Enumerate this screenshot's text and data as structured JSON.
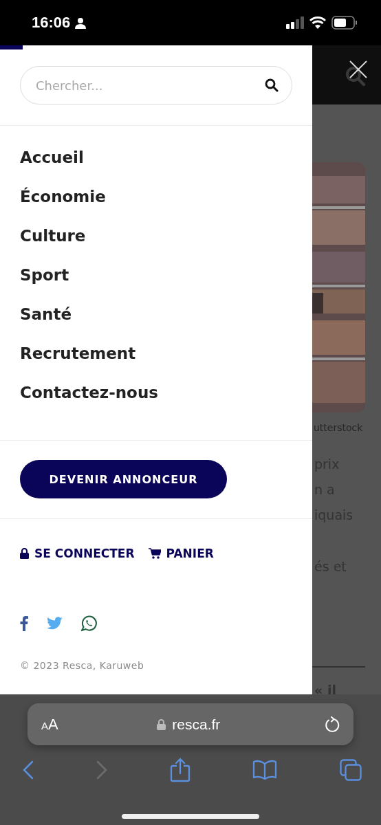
{
  "status_bar": {
    "time": "16:06"
  },
  "search": {
    "placeholder": "Chercher..."
  },
  "menu": [
    {
      "label": "Accueil"
    },
    {
      "label": "Économie"
    },
    {
      "label": "Culture"
    },
    {
      "label": "Sport"
    },
    {
      "label": "Santé"
    },
    {
      "label": "Recrutement"
    },
    {
      "label": "Contactez-nous"
    }
  ],
  "cta_button": "DEVENIR ANNONCEUR",
  "account_links": [
    {
      "kind": "login",
      "label": "SE CONNECTER"
    },
    {
      "kind": "cart",
      "label": "PANIER"
    }
  ],
  "social_links": [
    {
      "kind": "facebook"
    },
    {
      "kind": "twitter"
    },
    {
      "kind": "whatsapp"
    }
  ],
  "copyright": "© 2023 Resca, Karuweb",
  "background_page": {
    "caption": "utterstock",
    "paragraphs": [
      {
        "lines": [
          "prix",
          "n a",
          "iquais"
        ]
      },
      {
        "lines": [
          "és et"
        ]
      }
    ],
    "heading": "« il"
  },
  "browser": {
    "text_size_button": "AA",
    "url": "resca.fr",
    "back": {
      "disabled": false
    },
    "forward": {
      "disabled": true
    }
  }
}
